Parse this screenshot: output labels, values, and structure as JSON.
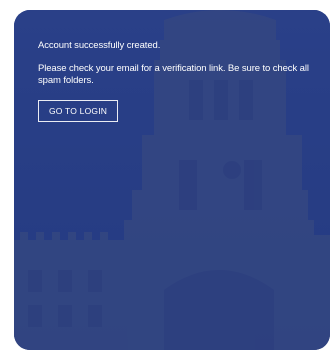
{
  "card": {
    "background_image": "oxford-tower-photo",
    "overlay_color": "#203887"
  },
  "message": {
    "line1": "Account successfully created.",
    "line2": "Please check your email for a verification link. Be sure to check all spam folders."
  },
  "actions": {
    "login_label": "GO TO LOGIN"
  }
}
